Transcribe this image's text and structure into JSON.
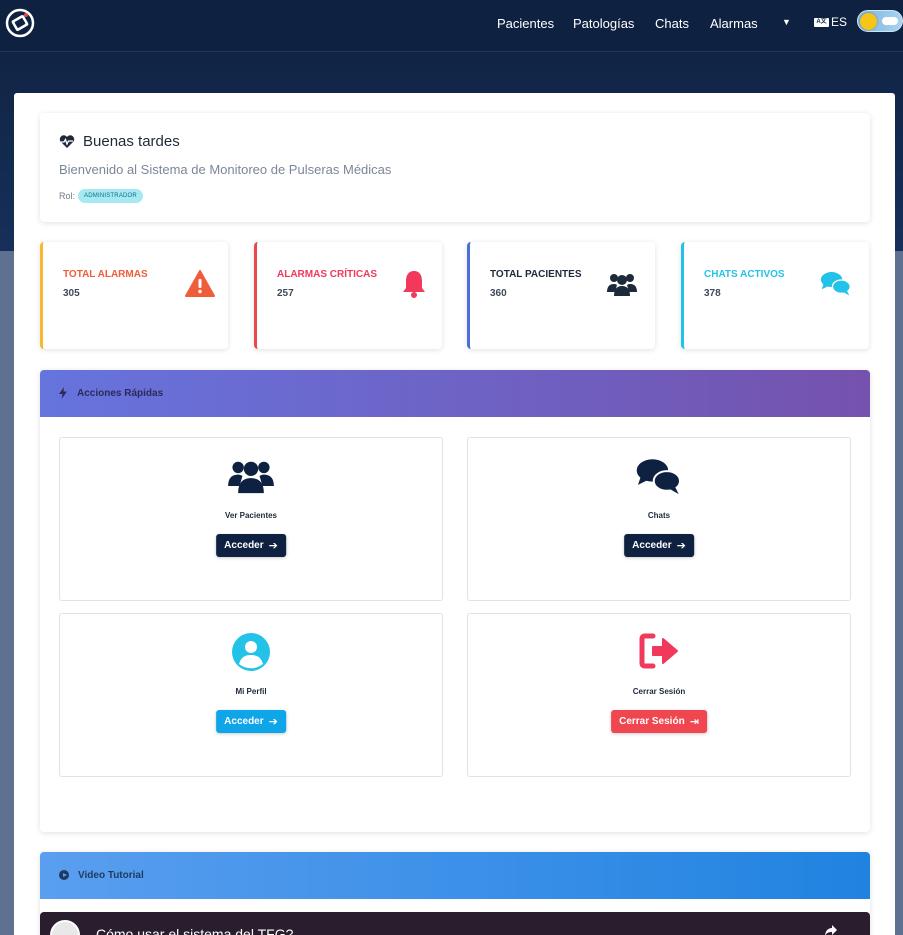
{
  "nav": {
    "items": [
      "Pacientes",
      "Patologías",
      "Chats",
      "Alarmas"
    ],
    "lang_icon": "A文",
    "lang": "ES"
  },
  "welcome": {
    "title": "Buenas tardes",
    "subtitle": "Bienvenido al Sistema de Monitoreo de Pulseras Médicas",
    "role_label": "Rol:",
    "role_badge": "ADMINISTRADOR"
  },
  "stats": [
    {
      "label": "TOTAL ALARMAS",
      "value": "305",
      "color": "#f05d3b",
      "border": "#f7b731",
      "icon": "warning-icon"
    },
    {
      "label": "ALARMAS CRÍTICAS",
      "value": "257",
      "color": "#f0395b",
      "border": "#e84a4a",
      "icon": "bell-icon"
    },
    {
      "label": "TOTAL PACIENTES",
      "value": "360",
      "color": "#1e2a3a",
      "border": "#4a6fd6",
      "icon": "users-icon"
    },
    {
      "label": "CHATS ACTIVOS",
      "value": "378",
      "color": "#23c2e8",
      "border": "#23c2e8",
      "icon": "comments-icon"
    }
  ],
  "quick_actions": {
    "title": "Acciones Rápidas",
    "items": [
      {
        "label": "Ver Pacientes",
        "button": "Acceder",
        "btn_color": "#0f2140"
      },
      {
        "label": "Chats",
        "button": "Acceder",
        "btn_color": "#0f2140"
      },
      {
        "label": "Mi Perfil",
        "button": "Acceder",
        "btn_color": "#0ea5e9"
      },
      {
        "label": "Cerrar Sesión",
        "button": "Cerrar Sesión",
        "btn_color": "#f0464f"
      }
    ]
  },
  "video": {
    "title": "Video Tutorial",
    "video_title": "Cómo usar el sistema del TFG?"
  },
  "colors": {
    "navy": "#0f2140",
    "purple_gradient": [
      "#6674de",
      "#7552ad"
    ],
    "blue_gradient": [
      "#5a9ef0",
      "#2083e0"
    ]
  }
}
